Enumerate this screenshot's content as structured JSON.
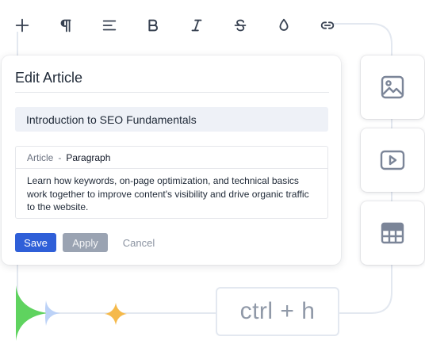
{
  "toolbar": {
    "icons": [
      "plus-icon",
      "pilcrow-icon",
      "align-left-icon",
      "bold-icon",
      "italic-icon",
      "strikethrough-icon",
      "drop-icon",
      "link-icon"
    ]
  },
  "editor_card": {
    "heading": "Edit Article",
    "title_value": "Introduction to SEO Fundamentals",
    "breadcrumb": {
      "type": "Article",
      "separator": "-",
      "block": "Paragraph"
    },
    "body_text": "Learn how keywords, on-page optimization, and technical basics work together to improve content's visibility and drive organic traffic to the website.",
    "save_label": "Save",
    "apply_label": "Apply",
    "cancel_label": "Cancel"
  },
  "insert_tiles": [
    "image-icon",
    "video-icon",
    "table-icon"
  ],
  "shortcut": {
    "label": "ctrl + h"
  },
  "colors": {
    "primary": "#2f5fd8",
    "muted_button": "#9aa3b2",
    "icon": "#374151",
    "tile_icon": "#7b8598",
    "green_accent": "#5fd35f",
    "blue_accent": "#bcd2f7",
    "orange_accent": "#f5b94a"
  }
}
